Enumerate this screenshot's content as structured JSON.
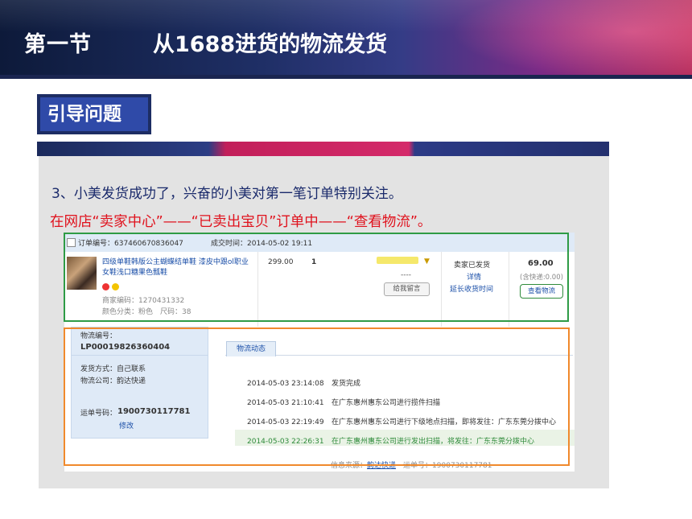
{
  "header": {
    "section": "第一节",
    "title": "从1688进货的物流发货"
  },
  "guide_label": "引导问题",
  "question": {
    "line1": "3、小美发货成功了，兴奋的小美对第一笔订单特别关注。",
    "line2": "在网店“卖家中心”——“已卖出宝贝”订单中——“查看物流”。"
  },
  "colors": {
    "header_dark": "#0d1a3a",
    "header_accent": "#b8305e",
    "guide_blue": "#2f4aa8",
    "question_text": "#1a2a6b",
    "question_highlight": "#e0121d",
    "green_box": "#2e9b45",
    "orange_box": "#f0892c"
  },
  "screenshot": {
    "order": {
      "number_label": "订单编号：637460670836047",
      "time_label": "成交时间：2014-05-02 19:11"
    },
    "product": {
      "name": "四级单鞋韩版公主蝴蝶结单鞋 漆皮中跟ol职业女鞋浅口糖果色瓢鞋",
      "code": "商家编码：1270431332",
      "color": "颜色分类：粉色　尺码：38",
      "price": "299.00",
      "quantity": "1"
    },
    "buyer": {
      "placeholder": "----",
      "message_button": "给我留言"
    },
    "status": {
      "text": "卖家已发货",
      "detail_link": "详情",
      "extend_link": "延长收货时间"
    },
    "amount": {
      "total": "69.00",
      "shipping": "(含快递:0.00)",
      "track_button": "查看物流"
    },
    "logistics": {
      "number_label": "物流编号：",
      "number": "LP00019826360404",
      "method": "发货方式：自己联系",
      "company": "物流公司：韵达快递",
      "waybill_label": "运单号码：",
      "waybill": "1900730117781",
      "edit_link": "修改"
    },
    "tab_label": "物流动态",
    "tracking": [
      {
        "time": "2014-05-03 23:14:08",
        "event": "发货完成"
      },
      {
        "time": "2014-05-03 21:10:41",
        "event": "在广东惠州惠东公司进行揽件扫描"
      },
      {
        "time": "2014-05-03 22:19:49",
        "event": "在广东惠州惠东公司进行下级地点扫描，即将发往：广东东莞分拨中心"
      },
      {
        "time": "2014-05-03 22:26:31",
        "event": "在广东惠州惠东公司进行发出扫描，将发往：广东东莞分拨中心"
      }
    ],
    "footer": {
      "source_label": "信息来源：",
      "source_link": "韵达快递",
      "waybill_label": "运单号：1900730117781"
    }
  }
}
